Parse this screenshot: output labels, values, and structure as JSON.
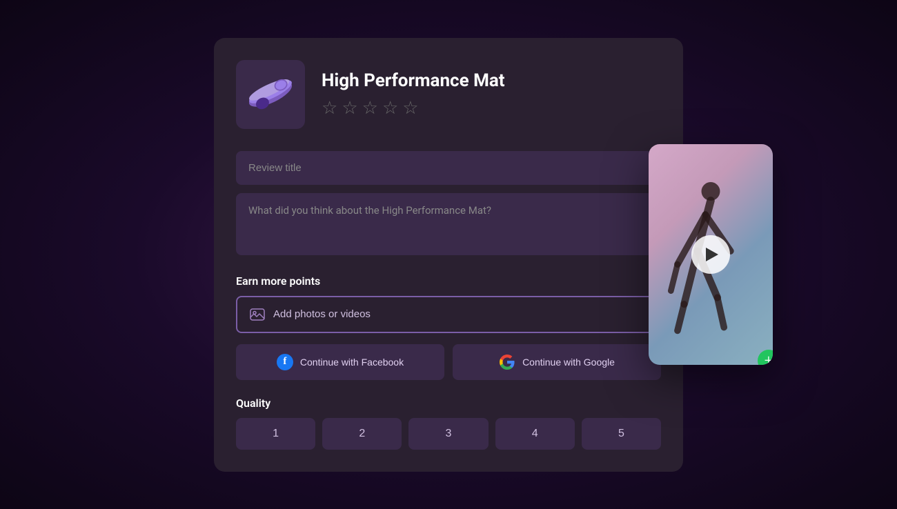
{
  "product": {
    "title": "High Performance Mat",
    "image_alt": "yoga mat",
    "stars": [
      "☆",
      "☆",
      "☆",
      "☆",
      "☆"
    ]
  },
  "form": {
    "review_title_placeholder": "Review title",
    "review_body_placeholder": "What did you think about the High Performance Mat?",
    "earn_label": "Earn more points",
    "add_media_label": "Add photos or videos",
    "facebook_btn_label": "Continue with Facebook",
    "google_btn_label": "Continue with Google",
    "quality_label": "Quality",
    "quality_options": [
      "1",
      "2",
      "3",
      "4",
      "5"
    ]
  },
  "video": {
    "play_label": "Play video"
  },
  "icons": {
    "plus": "+",
    "facebook_letter": "f"
  }
}
